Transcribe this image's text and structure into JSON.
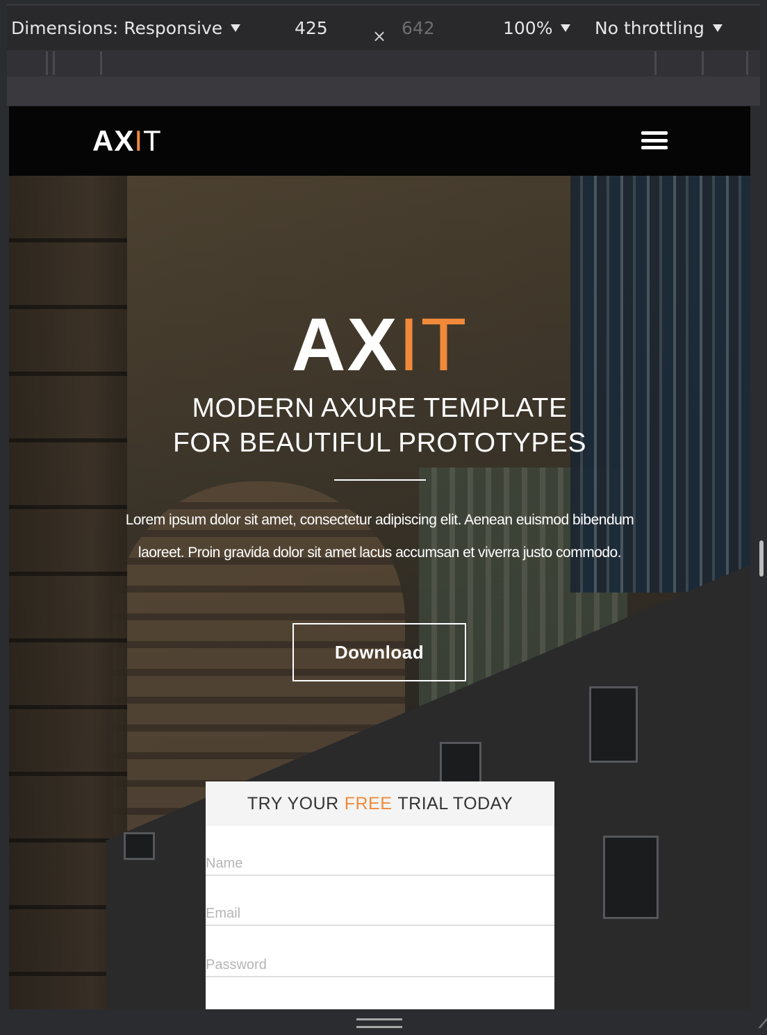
{
  "devtools": {
    "dimensions_label": "Dimensions: Responsive",
    "width_value": "425",
    "times_symbol": "×",
    "height_value": "642",
    "zoom_label": "100%",
    "throttling_label": "No throttling"
  },
  "site": {
    "nav": {
      "logo_ax": "AX",
      "logo_i": "I",
      "logo_t": "T"
    },
    "hero": {
      "logo_ax": "AX",
      "logo_it": "IT",
      "title_line1": "MODERN AXURE TEMPLATE",
      "title_line2": "FOR BEAUTIFUL PROTOTYPES",
      "body": "Lorem ipsum dolor sit amet, consectetur adipiscing elit. Aenean euismod bibendum laoreet. Proin gravida dolor sit amet lacus accumsan et viverra justo commodo.",
      "download_label": "Download"
    },
    "trial": {
      "head_pre": "TRY YOUR",
      "head_free": "FREE",
      "head_post": "TRIAL TODAY",
      "name_placeholder": "Name",
      "email_placeholder": "Email",
      "password_placeholder": "Password"
    }
  },
  "colors": {
    "accent": "#f08a3a",
    "navbar": "#050505",
    "devtools_bg": "#29292c"
  }
}
